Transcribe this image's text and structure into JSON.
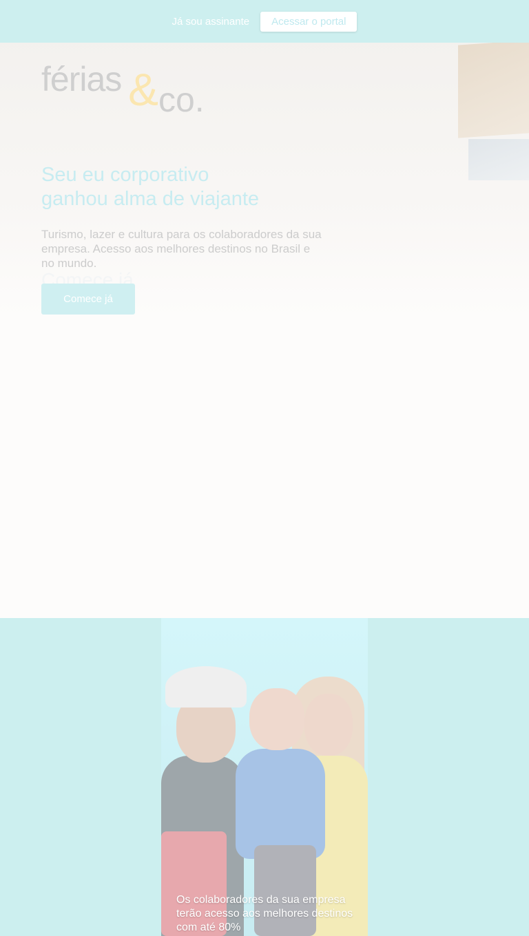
{
  "topbar": {
    "already_subscriber": "Já sou assinante",
    "portal_button": "Acessar o portal"
  },
  "logo": {
    "part1": "férias",
    "amp": "&",
    "part2": "co."
  },
  "hero": {
    "headline_line1": "Seu eu corporativo",
    "headline_line2": "ganhou alma de viajante",
    "subtext": "Turismo, lazer e cultura para os colaboradores da sua empresa. Acesso aos melhores destinos no Brasil e no mundo.",
    "ghost_text": "Comece já",
    "cta_label": "Comece já"
  },
  "benefits": {
    "card_text": "Os colaboradores da sua empresa terão acesso aos melhores destinos com até 80%"
  },
  "colors": {
    "topbar_bg": "#cdefef",
    "headline": "#c7ecf1",
    "accent_yellow": "#fbe6b0"
  }
}
